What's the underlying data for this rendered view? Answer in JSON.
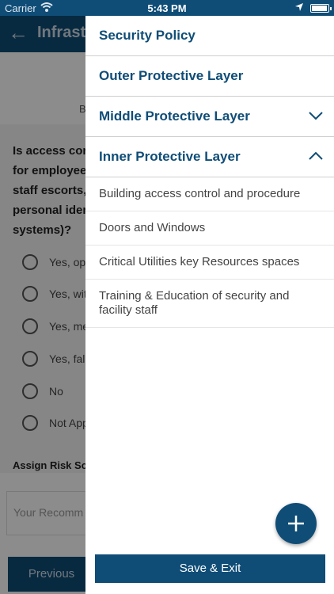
{
  "status_bar": {
    "carrier": "Carrier",
    "time": "5:43 PM"
  },
  "background": {
    "title": "Infrastr",
    "subtitle": "B",
    "question": "Is access cont for employee staff escorts, personal iden systems)?",
    "question_lines": [
      "Is access cont",
      "for employee",
      "staff escorts,",
      "personal iden",
      "systems)?"
    ],
    "options": [
      "Yes, opt",
      "Yes, wit",
      "Yes, me",
      "Yes, fall",
      "No",
      "Not App"
    ],
    "risk_label": "Assign Risk Sca",
    "recommendation_placeholder": "Your Recomm",
    "previous_label": "Previous"
  },
  "drawer": {
    "sections": [
      {
        "label": "Security Policy",
        "state": "none"
      },
      {
        "label": "Outer Protective Layer",
        "state": "none"
      },
      {
        "label": "Middle Protective Layer",
        "state": "collapsed"
      },
      {
        "label": "Inner Protective Layer",
        "state": "expanded"
      }
    ],
    "items": [
      "Building access control and procedure",
      "Doors and Windows",
      "Critical Utilities key Resources spaces",
      "Training & Education of security and facility staff"
    ],
    "fab_icon": "plus-icon",
    "save_exit_label": "Save & Exit"
  },
  "colors": {
    "brand": "#0f4d77",
    "divider": "#cfcfcf"
  }
}
